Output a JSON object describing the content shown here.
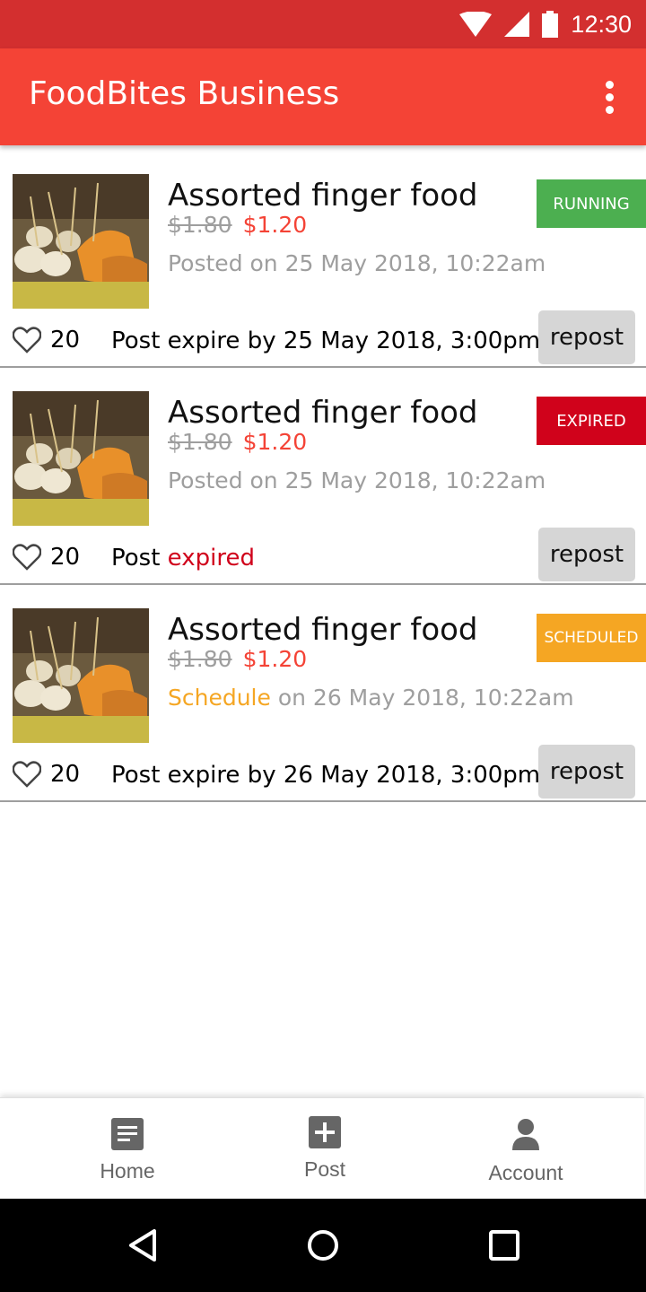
{
  "status_bar": {
    "time": "12:30"
  },
  "app_bar": {
    "title": "FoodBites Business"
  },
  "posts": [
    {
      "title": "Assorted finger food",
      "price_old": "$1.80",
      "price_new": "$1.20",
      "posted_prefix": "Posted on 25 May 2018, 10:22am",
      "status": "RUNNING",
      "likes": "20",
      "expire_text": "Post expire by 25 May 2018, 3:00pm",
      "repost_label": "repost"
    },
    {
      "title": "Assorted finger food",
      "price_old": "$1.80",
      "price_new": "$1.20",
      "posted_prefix": "Posted on 25 May 2018, 10:22am",
      "status": "EXPIRED",
      "likes": "20",
      "expire_prefix": "Post ",
      "expire_highlight": "expired",
      "repost_label": "repost"
    },
    {
      "title": "Assorted finger food",
      "price_old": "$1.80",
      "price_new": "$1.20",
      "schedule_word": "Schedule",
      "schedule_rest": " on 26 May 2018, 10:22am",
      "status": "SCHEDULED",
      "likes": "20",
      "expire_text": "Post expire by 26 May 2018, 3:00pm",
      "repost_label": "repost"
    }
  ],
  "bottom_nav": {
    "items": [
      {
        "label": "Home",
        "icon": "document-icon"
      },
      {
        "label": "Post",
        "icon": "add-box-icon"
      },
      {
        "label": "Account",
        "icon": "person-icon"
      }
    ]
  },
  "colors": {
    "status_bar": "#d32f2f",
    "app_bar": "#f44336",
    "running": "#4caf50",
    "expired": "#d0021b",
    "scheduled": "#f5a623"
  }
}
